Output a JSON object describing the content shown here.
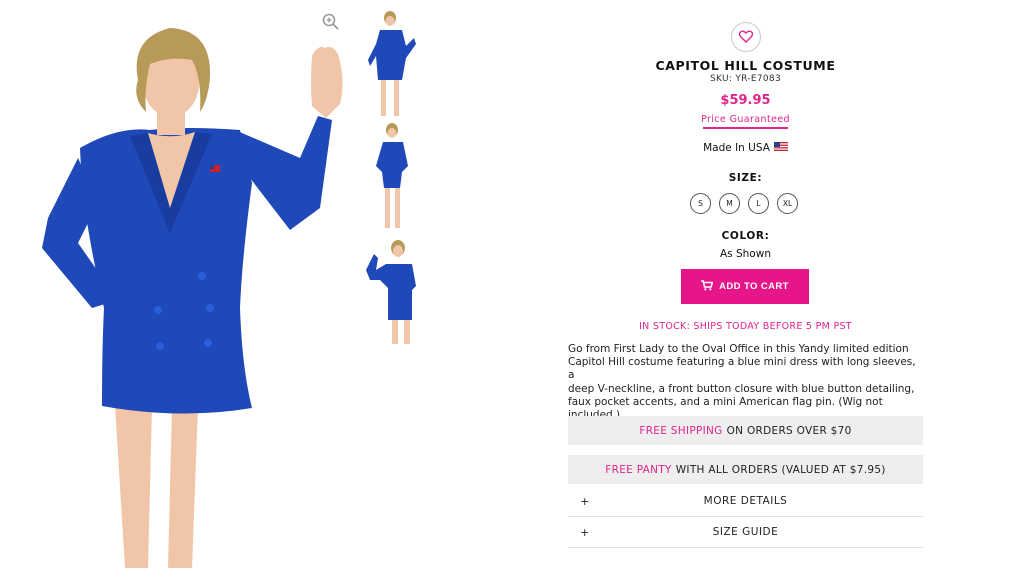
{
  "product": {
    "title": "CAPITOL HILL COSTUME",
    "sku": "SKU: YR-E7083",
    "price": "$59.95",
    "price_guarantee": "Price Guaranteed",
    "made_in": "Made In USA"
  },
  "size": {
    "label": "SIZE:",
    "options": [
      "S",
      "M",
      "L",
      "XL"
    ]
  },
  "color": {
    "label": "COLOR:",
    "value": "As Shown"
  },
  "cart": {
    "label": "ADD TO CART"
  },
  "stock": "IN STOCK: SHIPS TODAY BEFORE 5 PM PST",
  "description": [
    "Go from First Lady to the Oval Office in this Yandy limited edition",
    "Capitol Hill costume featuring a blue mini dress with long sleeves, a",
    "deep V-neckline, a front button closure with blue button detailing,",
    "faux pocket accents, and a mini American flag pin. (Wig not",
    "included.)"
  ],
  "promos": {
    "shipping_highlight": "FREE SHIPPING",
    "shipping_rest": "ON ORDERS OVER $70",
    "panty_highlight": "FREE PANTY",
    "panty_rest": "WITH ALL ORDERS (VALUED AT $7.95)"
  },
  "accordion": {
    "more_details": "MORE DETAILS",
    "size_guide": "SIZE GUIDE",
    "expand_symbol": "+"
  },
  "colors": {
    "accent_pink": "#e0258c",
    "dress_blue": "#1f48b8",
    "banner_gray": "#eeeeee"
  },
  "icons": [
    "zoom-in-icon",
    "heart-icon",
    "cart-icon",
    "us-flag-icon",
    "plus-icon"
  ]
}
